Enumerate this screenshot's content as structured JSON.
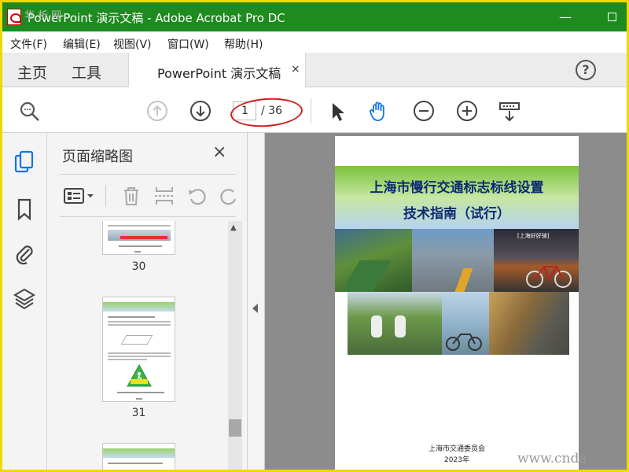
{
  "window": {
    "title": "PowerPoint 演示文稿 - Adobe Acrobat Pro DC",
    "minimize": "—"
  },
  "menu": [
    "文件(F)",
    "编辑(E)",
    "视图(V)",
    "窗口(W)",
    "帮助(H)"
  ],
  "tabs": {
    "home": "主页",
    "tools": "工具",
    "document": "PowerPoint 演示文稿",
    "close": "×",
    "help": "?"
  },
  "toolbar": {
    "current_page": "1",
    "total_pages": "/ 36"
  },
  "thumbnails": {
    "title": "页面缩略图",
    "close": "×",
    "pages": [
      {
        "number": "30"
      },
      {
        "number": "31"
      }
    ]
  },
  "document": {
    "title_line1": "上海市慢行交通标志标线设置",
    "title_line2": "技术指南（试行）",
    "photo_caption": "[上海好好骑]",
    "organization": "上海市交通委员会",
    "year": "2023年"
  },
  "watermarks": {
    "left": "华 析 网",
    "right": "www.cnda"
  },
  "colors": {
    "titlebar": "#1e8a1f",
    "accent_blue": "#1473e6",
    "annotation_red": "#d02020",
    "banner_text": "#0d2a73"
  }
}
